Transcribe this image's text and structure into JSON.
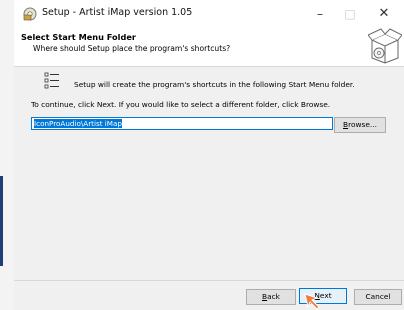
{
  "window": {
    "title": "Setup - Artist iMap version 1.05"
  },
  "titlebar": {
    "minimize": "–",
    "maximize": "□",
    "close": "✕"
  },
  "header": {
    "heading": "Select Start Menu Folder",
    "subheading": "Where should Setup place the program's shortcuts?"
  },
  "body": {
    "info": "Setup will create the program's shortcuts in the following Start Menu folder.",
    "instruction": "To continue, click Next. If you would like to select a different folder, click Browse.",
    "folder_value": "IconProAudio\\Artist iMap"
  },
  "buttons": {
    "browse_u": "B",
    "browse_rest": "rowse...",
    "back_u": "B",
    "back_rest": "ack",
    "next_u": "N",
    "next_rest": "ext",
    "cancel": "Cancel"
  },
  "colors": {
    "accent": "#0078d7",
    "selection": "#0078d7",
    "cursor": "#f07b3a"
  },
  "icons": [
    "setup-app-icon",
    "wizard-box-icon",
    "start-menu-list-icon",
    "mouse-cursor-icon"
  ]
}
